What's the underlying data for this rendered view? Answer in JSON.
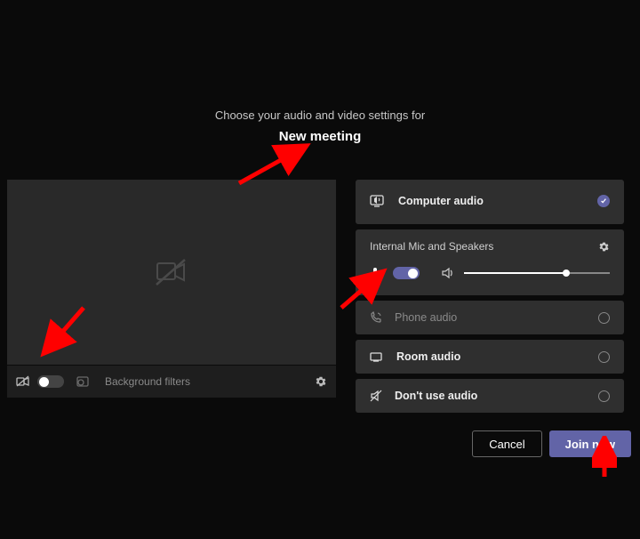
{
  "header": {
    "subtitle": "Choose your audio and video settings for",
    "title": "New meeting"
  },
  "left": {
    "camera_on": false,
    "bg_filters_label": "Background filters"
  },
  "audio": {
    "computer": {
      "label": "Computer audio",
      "selected": true,
      "device_label": "Internal Mic and Speakers",
      "mic_on": true,
      "volume_percent": 70
    },
    "phone": {
      "label": "Phone audio"
    },
    "room": {
      "label": "Room audio"
    },
    "none": {
      "label": "Don't use audio"
    }
  },
  "footer": {
    "cancel": "Cancel",
    "join": "Join now"
  },
  "colors": {
    "accent": "#6264a7",
    "arrow": "#ff0000"
  }
}
